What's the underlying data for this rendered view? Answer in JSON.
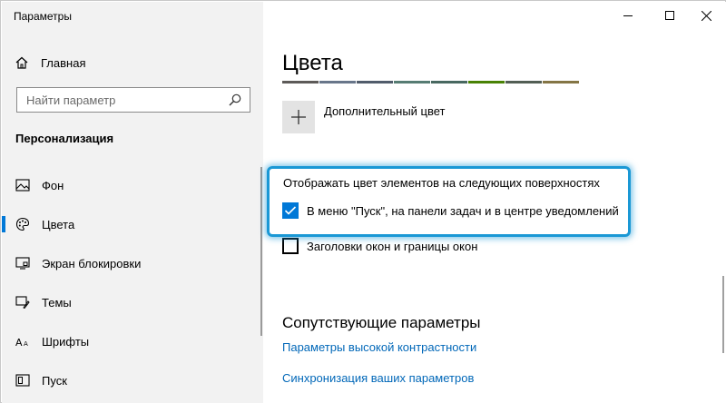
{
  "window": {
    "title": "Параметры"
  },
  "caption": {
    "minimize_icon": "minimize-icon",
    "maximize_icon": "maximize-icon",
    "close_icon": "close-icon"
  },
  "sidebar": {
    "home_label": "Главная",
    "search_placeholder": "Найти параметр",
    "section_title": "Персонализация",
    "items": [
      {
        "label": "Фон",
        "icon": "picture-icon",
        "active": false
      },
      {
        "label": "Цвета",
        "icon": "palette-icon",
        "active": true
      },
      {
        "label": "Экран блокировки",
        "icon": "lock-screen-icon",
        "active": false
      },
      {
        "label": "Темы",
        "icon": "brush-icon",
        "active": false
      },
      {
        "label": "Шрифты",
        "icon": "font-icon",
        "active": false
      },
      {
        "label": "Пуск",
        "icon": "start-icon",
        "active": false
      }
    ]
  },
  "main": {
    "title": "Цвета",
    "swatch_colors": [
      "#5d5a58",
      "#68768a",
      "#515c6b",
      "#567c73",
      "#486860",
      "#498205",
      "#525e54",
      "#847545"
    ],
    "custom_color_label": "Дополнительный цвет",
    "surfaces_label": "Отображать цвет элементов на следующих поверхностях",
    "checkbox_start_label": "В меню \"Пуск\", на панели задач и в центре уведомлений",
    "checkbox_start_checked": true,
    "checkbox_titlebars_label": "Заголовки окон и границы окон",
    "checkbox_titlebars_checked": false,
    "related_title": "Сопутствующие параметры",
    "link_high_contrast": "Параметры высокой контрастности",
    "link_sync": "Синхронизация ваших параметров"
  },
  "colors": {
    "accent": "#0078d7",
    "highlight_frame": "#1a98d5",
    "link": "#0067b8"
  }
}
